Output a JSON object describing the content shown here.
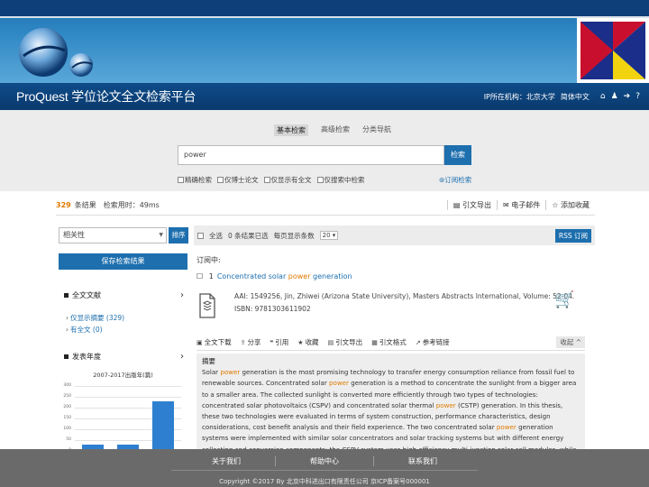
{
  "header": {
    "brand": "ProQuest 学位论文全文检索平台",
    "institution": "IP所在机构：北京大学",
    "language": "简体中文",
    "icons": [
      "home-icon",
      "user-icon",
      "logout-icon",
      "help-icon"
    ]
  },
  "search": {
    "tabs": [
      {
        "label": "基本检索",
        "active": true
      },
      {
        "label": "高级检索",
        "active": false
      },
      {
        "label": "分类导航",
        "active": false
      }
    ],
    "query": "power",
    "button_label": "检索",
    "filters": [
      "精确检索",
      "仅博士论文",
      "仅显示有全文",
      "仅搜索中检索"
    ],
    "subscribe_label": "订阅检索"
  },
  "results": {
    "count": "329",
    "count_label": "条结果",
    "time_label": "检索用时：",
    "time_value": "49ms",
    "actions": [
      {
        "icon": "list-icon",
        "label": "引文导出"
      },
      {
        "icon": "mail-icon",
        "label": "电子邮件"
      },
      {
        "icon": "star-icon",
        "label": "添加收藏"
      }
    ]
  },
  "sort": {
    "selected": "相关性",
    "button_label": "排序",
    "select_all_label": "全选",
    "selected_count_text": "0 条结果已选",
    "per_page_label": "每页显示条数",
    "per_page_value": "20",
    "rss_label": "RSS 订阅"
  },
  "sidebar": {
    "save_button": "保存检索结果",
    "facets": [
      {
        "title": "全文文献",
        "items": [
          {
            "label": "仅显示摘要",
            "count": "(329)"
          },
          {
            "label": "有全文",
            "count": "(0)"
          }
        ]
      },
      {
        "title": "发表年度"
      }
    ],
    "chart": {
      "title": "2007-2017出版年(篇)"
    }
  },
  "chart_data": {
    "type": "bar",
    "title": "2007-2017出版年(篇)",
    "categories": [
      "",
      "",
      ""
    ],
    "values": [
      30,
      28,
      230
    ],
    "yticks": [
      "300",
      "250",
      "200",
      "150",
      "100",
      "50",
      "0"
    ],
    "ylim": [
      0,
      300
    ]
  },
  "result_item": {
    "path_label": "订阅中:",
    "index": "1",
    "title_pre": "Concentrated solar ",
    "title_hl": "power",
    "title_post": " generation",
    "meta_line1": "AAI: 1549256, Jin, Zhiwei (Arizona State University), Masters Abstracts International, Volume: 52-04.",
    "meta_line2": "ISBN: 9781303611902",
    "tools": [
      {
        "icon": "disk-icon",
        "label": "全文下载"
      },
      {
        "icon": "share-icon",
        "label": "分享"
      },
      {
        "icon": "quote-icon",
        "label": "引用"
      },
      {
        "icon": "star-icon",
        "label": "收藏"
      },
      {
        "icon": "export-icon",
        "label": "引文导出"
      },
      {
        "icon": "format-icon",
        "label": "引文格式"
      },
      {
        "icon": "link-icon",
        "label": "参考链接"
      }
    ],
    "collapse_label": "收起 ^",
    "abstract_label": "摘要",
    "abstract_segments": [
      {
        "t": "Solar ",
        "hl": false
      },
      {
        "t": "power",
        "hl": true
      },
      {
        "t": " generation is the most promising technology to transfer energy consumption reliance from fossil fuel to renewable sources. Concentrated solar ",
        "hl": false
      },
      {
        "t": "power",
        "hl": true
      },
      {
        "t": " generation is a method to concentrate the sunlight from a bigger area to a smaller area. The collected sunlight is converted more efficiently through two types of technologies: concentrated solar photovoltaics (CSPV) and concentrated solar thermal ",
        "hl": false
      },
      {
        "t": "power",
        "hl": true
      },
      {
        "t": " (CSTP) generation. In this thesis, these two technologies were evaluated in terms of system construction, performance characteristics, design considerations, cost benefit analysis and their field experience. The two concentrated solar ",
        "hl": false
      },
      {
        "t": "power",
        "hl": true
      },
      {
        "t": " generation systems were implemented with similar solar concentrators and solar tracking systems but with different energy collecting and conversion components: the CSPV system uses high efficiency multi-junction solar cell modules, while",
        "hl": false
      }
    ]
  },
  "footer": {
    "links": [
      "关于我们",
      "帮助中心",
      "联系我们"
    ],
    "copyright": "Copyright ©2017 By 北京中科进出口有限责任公司 京ICP备案号000001"
  }
}
